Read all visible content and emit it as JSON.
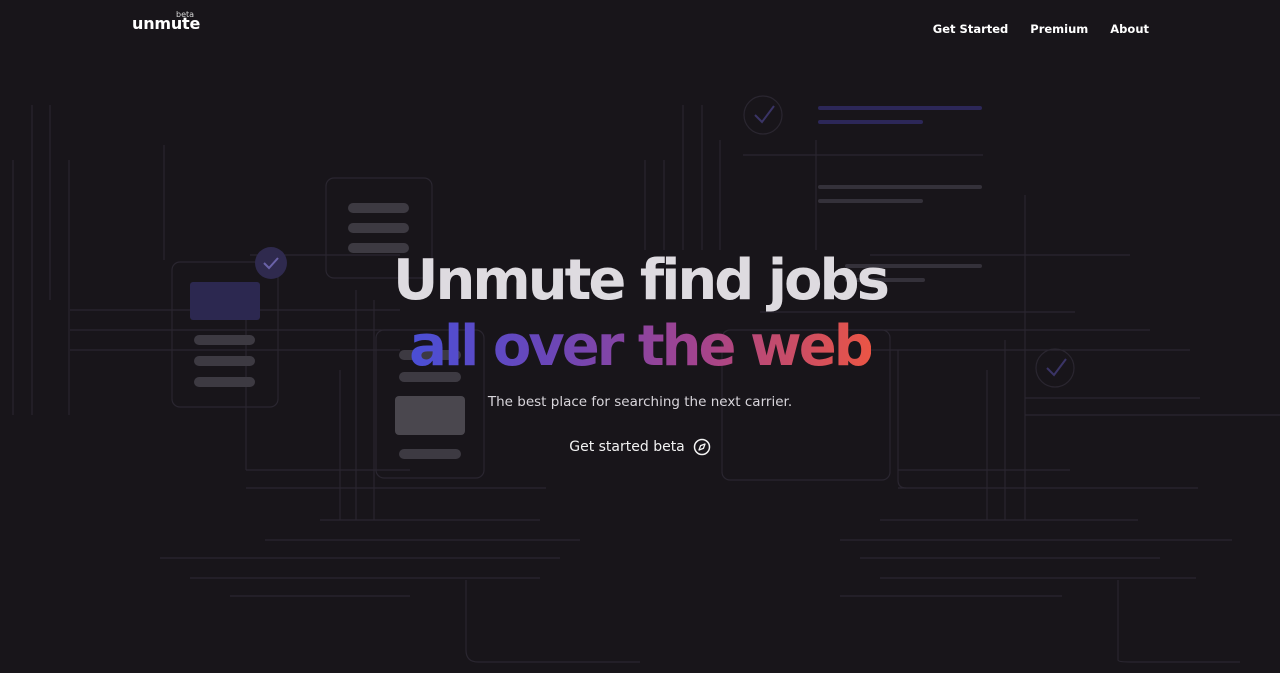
{
  "header": {
    "logo": "unmute",
    "logo_badge": "beta",
    "nav": [
      {
        "label": "Get Started"
      },
      {
        "label": "Premium"
      },
      {
        "label": "About"
      }
    ]
  },
  "hero": {
    "title_line1": "Unmute find jobs",
    "title_line2": "all over the web",
    "subtitle": "The best place for searching the next carrier.",
    "cta_label": "Get started beta",
    "cta_icon": "compass-icon"
  },
  "colors": {
    "background": "#18151a",
    "gradient": [
      "#4a4fd6",
      "#6a46b8",
      "#a2438f",
      "#ea5545"
    ]
  }
}
